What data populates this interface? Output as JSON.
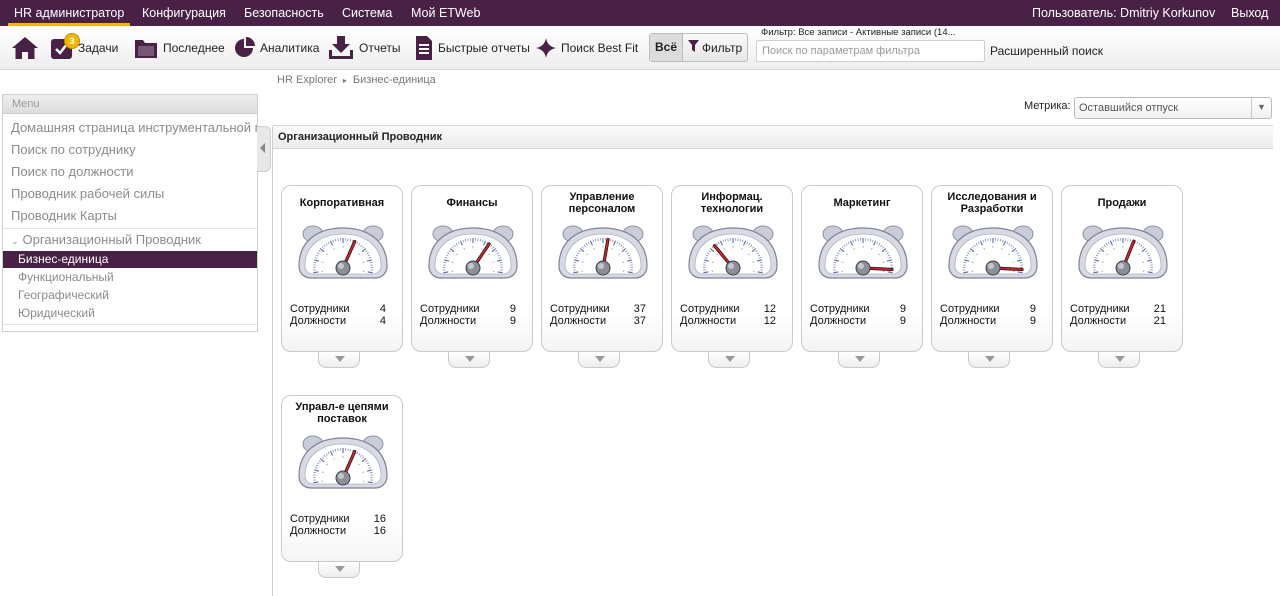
{
  "topnav": {
    "items": [
      "HR администратор",
      "Конфигурация",
      "Безопасность",
      "Система",
      "Мой ETWeb"
    ],
    "user": "Пользователь: Dmitriy Korkunov",
    "logout": "Выход"
  },
  "toolbar": {
    "home_icon": "home-icon",
    "tasks": {
      "label": "Задачи",
      "badge": "3"
    },
    "recent": "Последнее",
    "analytics": "Аналитика",
    "reports": "Отчеты",
    "quick_reports": "Быстрые отчеты",
    "best_fit": "Поиск Best Fit",
    "all": "Всё",
    "filter": "Фильтр",
    "filter_caption": "Фильтр: Все записи - Активные записи (14...",
    "filter_placeholder": "Поиск по параметрам фильтра",
    "advanced_search": "Расширенный поиск"
  },
  "menu": {
    "header": "Menu",
    "items": [
      "Домашняя страница инструментальной панели",
      "Поиск по сотруднику",
      "Поиск по должности",
      "Проводник рабочей силы",
      "Проводник Карты"
    ],
    "group": "Организационный Проводник",
    "selected": "Бизнес-единица",
    "subitems": [
      "Функциональный",
      "Географический",
      "Юридический"
    ]
  },
  "breadcrumb": [
    "HR Explorer",
    "Бизнес-единица"
  ],
  "metric": {
    "label": "Метрика:",
    "value": "Оставшийся отпуск"
  },
  "panel": {
    "title": "Организационный Проводник"
  },
  "cards": [
    {
      "title": "Корпоративная",
      "employees_label": "Сотрудники",
      "employees": "4",
      "positions_label": "Должности",
      "positions": "4",
      "needle": 0.62
    },
    {
      "title": "Финансы",
      "employees_label": "Сотрудники",
      "employees": "9",
      "positions_label": "Должности",
      "positions": "9",
      "needle": 0.67
    },
    {
      "title": "Управление персоналом",
      "employees_label": "Сотрудники",
      "employees": "37",
      "positions_label": "Должности",
      "positions": "37",
      "needle": 0.55
    },
    {
      "title": "Информац. технологии",
      "employees_label": "Сотрудники",
      "employees": "12",
      "positions_label": "Должности",
      "positions": "12",
      "needle": 0.3
    },
    {
      "title": "Маркетинг",
      "employees_label": "Сотрудники",
      "employees": "9",
      "positions_label": "Должности",
      "positions": "9",
      "needle": 0.97
    },
    {
      "title": "Исследования и Разработки",
      "employees_label": "Сотрудники",
      "employees": "9",
      "positions_label": "Должности",
      "positions": "9",
      "needle": 0.97
    },
    {
      "title": "Продажи",
      "employees_label": "Сотрудники",
      "employees": "21",
      "positions_label": "Должности",
      "positions": "21",
      "needle": 0.61
    },
    {
      "title": "Управл-е цепями поставок",
      "employees_label": "Сотрудники",
      "employees": "16",
      "positions_label": "Должности",
      "positions": "16",
      "needle": 0.62
    }
  ],
  "colors": {
    "brand": "#4a2146",
    "accent": "#f2b705",
    "needle": "#c0282d"
  }
}
